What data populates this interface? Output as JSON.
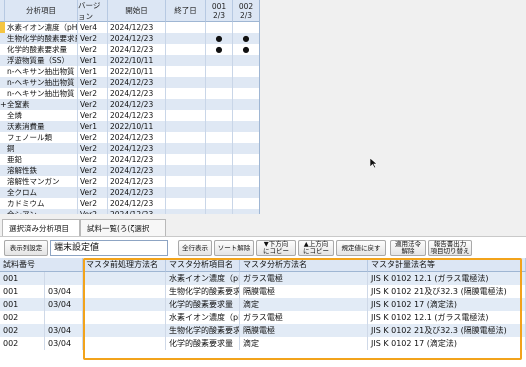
{
  "top_grid": {
    "headers": {
      "analysis_item": "分析項目",
      "version": "バージョン",
      "start_date": "開始日",
      "end_date": "終了日",
      "col1_top": "001",
      "col1_bottom": "2/3",
      "col2_top": "002",
      "col2_bottom": "2/3"
    },
    "rows": [
      {
        "item": "水素イオン濃度（pH）",
        "version": "Ver4",
        "start": "2024/12/23",
        "d1": "",
        "d2": "",
        "mark": "selected"
      },
      {
        "item": "生物化学的酸素要求量",
        "version": "Ver2",
        "start": "2024/12/23",
        "d1": "●",
        "d2": "●",
        "mark": ""
      },
      {
        "item": "化学的酸素要求量",
        "version": "Ver2",
        "start": "2024/12/23",
        "d1": "●",
        "d2": "●",
        "mark": ""
      },
      {
        "item": "浮遊物質量（SS）",
        "version": "Ver1",
        "start": "2022/10/11",
        "d1": "",
        "d2": "",
        "mark": ""
      },
      {
        "item": "n-ヘキサン抽出物質",
        "version": "Ver1",
        "start": "2022/10/11",
        "d1": "",
        "d2": "",
        "mark": ""
      },
      {
        "item": "n-ヘキサン抽出物質",
        "version": "Ver2",
        "start": "2024/12/23",
        "d1": "",
        "d2": "",
        "mark": ""
      },
      {
        "item": "n-ヘキサン抽出物質",
        "version": "Ver2",
        "start": "2024/12/23",
        "d1": "",
        "d2": "",
        "mark": ""
      },
      {
        "item": "全窒素",
        "version": "Ver2",
        "start": "2024/12/23",
        "d1": "",
        "d2": "",
        "mark": "+"
      },
      {
        "item": "全燐",
        "version": "Ver2",
        "start": "2024/12/23",
        "d1": "",
        "d2": "",
        "mark": ""
      },
      {
        "item": "沃素消費量",
        "version": "Ver1",
        "start": "2022/10/11",
        "d1": "",
        "d2": "",
        "mark": ""
      },
      {
        "item": "フェノール類",
        "version": "Ver2",
        "start": "2024/12/23",
        "d1": "",
        "d2": "",
        "mark": ""
      },
      {
        "item": "銅",
        "version": "Ver2",
        "start": "2024/12/23",
        "d1": "",
        "d2": "",
        "mark": ""
      },
      {
        "item": "亜鉛",
        "version": "Ver2",
        "start": "2024/12/23",
        "d1": "",
        "d2": "",
        "mark": ""
      },
      {
        "item": "溶解性鉄",
        "version": "Ver2",
        "start": "2024/12/23",
        "d1": "",
        "d2": "",
        "mark": ""
      },
      {
        "item": "溶解性マンガン",
        "version": "Ver2",
        "start": "2024/12/23",
        "d1": "",
        "d2": "",
        "mark": ""
      },
      {
        "item": "全クロム",
        "version": "Ver2",
        "start": "2024/12/23",
        "d1": "",
        "d2": "",
        "mark": ""
      },
      {
        "item": "カドミウム",
        "version": "Ver2",
        "start": "2024/12/23",
        "d1": "",
        "d2": "",
        "mark": ""
      },
      {
        "item": "全シアン",
        "version": "Ver2",
        "start": "2024/12/23",
        "d1": "",
        "d2": "",
        "mark": ""
      }
    ]
  },
  "tabs": [
    {
      "label": "選択済み分析項目",
      "active": true
    },
    {
      "label": "試料一覧(ろ(ζ選択用)",
      "active": false
    }
  ],
  "toolbar": {
    "display_settings": "表示列設定",
    "terminal_setting_value": "端末設定値",
    "show_all": "全行表示",
    "sort_release": "ソート解除",
    "copy_down_1": "▼下方向",
    "copy_down_2": "にコピー",
    "copy_up_1": "▲上方向",
    "copy_up_2": "にコピー",
    "reset_default": "規定値に戻す",
    "apply_1": "適用法令",
    "apply_2": "解除",
    "report_1": "報告書出力",
    "report_2": "項目切り替え"
  },
  "bottom_grid": {
    "headers": [
      "試料番号",
      "マスタ前処理方法名",
      "マスタ分析項目名",
      "マスタ分析方法名",
      "マスタ計量法名等"
    ],
    "rows": [
      {
        "sample": "001",
        "date": "",
        "pre": "",
        "item": "水素イオン濃度（pH）",
        "method": "ガラス電極",
        "measure": "JIS K 0102 12.1 (ガラス電極法)"
      },
      {
        "sample": "001",
        "date": "03/04",
        "pre": "",
        "item": "生物化学的酸素要求量",
        "method": "隔膜電極",
        "measure": "JIS K 0102 21及び32.3 (隔膜電極法)"
      },
      {
        "sample": "001",
        "date": "03/04",
        "pre": "",
        "item": "化学的酸素要求量",
        "method": "滴定",
        "measure": "JIS K 0102 17 (滴定法)"
      },
      {
        "sample": "002",
        "date": "",
        "pre": "",
        "item": "水素イオン濃度（pH）",
        "method": "ガラス電極",
        "measure": "JIS K 0102 12.1 (ガラス電極法)"
      },
      {
        "sample": "002",
        "date": "03/04",
        "pre": "",
        "item": "生物化学的酸素要求量",
        "method": "隔膜電極",
        "measure": "JIS K 0102 21及び32.3 (隔膜電極法)"
      },
      {
        "sample": "002",
        "date": "03/04",
        "pre": "",
        "item": "化学的酸素要求量",
        "method": "滴定",
        "measure": "JIS K 0102 17 (滴定法)"
      }
    ]
  },
  "colors": {
    "highlight": "#f2a31b",
    "header": "#dce6f4",
    "row_alt": "#dfe8f4"
  }
}
